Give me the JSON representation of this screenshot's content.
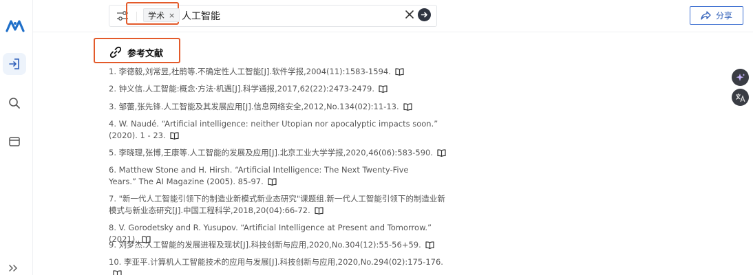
{
  "search": {
    "chip_label": "学术",
    "chip_remove": "×",
    "query": "人工智能"
  },
  "header": {
    "share_label": "分享"
  },
  "references": {
    "title": "参考文献",
    "items": [
      "1. 李德毅,刘常昱,杜鹃等.不确定性人工智能[J].软件学报,2004(11):1583-1594.",
      "2. 钟义信.人工智能:概念·方法·机遇[J].科学通报,2017,62(22):2473-2479.",
      "3. 邹蕾,张先锋.人工智能及其发展应用[J].信息网络安全,2012,No.134(02):11-13.",
      "4. W. Naudé. “Artificial intelligence: neither Utopian nor apocalyptic impacts soon.” (2020). 1 - 23.",
      "5. 李晓理,张博,王康等.人工智能的发展及应用[J].北京工业大学学报,2020,46(06):583-590.",
      "6. Matthew Stone and H. Hirsh. “Artificial Intelligence: The Next Twenty-Five Years.” The AI Magazine (2005). 85-97.",
      "7. \"新一代人工智能引领下的制造业新模式新业态研究\"课题组.新一代人工智能引领下的制造业新模式与新业态研究[J].中国工程科学,2018,20(04):66-72.",
      "8. V. Gorodetsky and R. Yusupov. “Artificial Intelligence at Present and Tomorrow.” (2021).",
      "9. 刘梦杰.人工智能的发展进程及现状[J].科技创新与应用,2020,No.304(12):55-56+59.",
      "10. 李亚平.计算机人工智能技术的应用与发展[J].科技创新与应用,2020,No.294(02):175-176."
    ]
  },
  "icons": {
    "logo": "app-logo",
    "filter": "sliders-icon",
    "clear": "close-icon",
    "submit": "arrow-right-icon",
    "share": "share-arrow-icon",
    "link": "link-icon",
    "book": "open-book-icon",
    "sparkle": "sparkle-icon",
    "translate": "translate-icon",
    "login": "sign-in-icon",
    "search": "search-icon",
    "panel": "window-icon",
    "expand": "chevrons-right-icon"
  },
  "colors": {
    "accent": "#2f5fb9",
    "highlight_box": "#e35a2a",
    "rail_active": "#edf3fb"
  }
}
